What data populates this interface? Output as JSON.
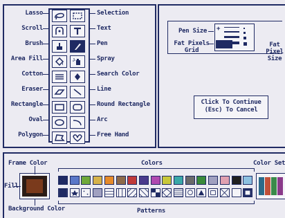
{
  "tools_left": [
    "Lasso",
    "Scroll",
    "Brush",
    "Area Fill",
    "Cotton",
    "Eraser",
    "Rectangle",
    "Oval",
    "Polygon"
  ],
  "tools_right": [
    "Selection",
    "Text",
    "Pen",
    "Spray",
    "Search Color",
    "Line",
    "Round Rectangle",
    "Arc",
    "Free Hand"
  ],
  "pen_size_panel": {
    "pen_size_label": "Pen Size",
    "fat_pixels_grid_label": "Fat Pixels Grid",
    "fat_pixel_size_label": "Fat Pixel Size"
  },
  "dialog": {
    "continue_line": "Click To Continue",
    "cancel_line": "(Esc) To Cancel"
  },
  "palette": {
    "frame_color_label": "Frame Color",
    "colors_label": "Colors",
    "color_set_label": "Color Set",
    "fill_label": "Fill",
    "background_color_label": "Background Color",
    "patterns_label": "Patterns",
    "frame_color": "#2b1c16",
    "fill_color": "#7a3a1c",
    "background_color": "#f4f4f8",
    "color_swatches": [
      "#1f2a63",
      "#5a77c8",
      "#6fa83a",
      "#d6b24a",
      "#e58a2a",
      "#8d6a4a",
      "#c03a3a",
      "#4a3a8c",
      "#b04ab0",
      "#c8c83a",
      "#3aa8a8",
      "#6a6a6a",
      "#3a8a3a",
      "#a0a0c0",
      "#e0a0b0",
      "#202020",
      "#8cc0e0"
    ],
    "color_set_colors": [
      "#2a6a8a",
      "#c0503a",
      "#3a8a4a",
      "#8a3a8a"
    ]
  }
}
